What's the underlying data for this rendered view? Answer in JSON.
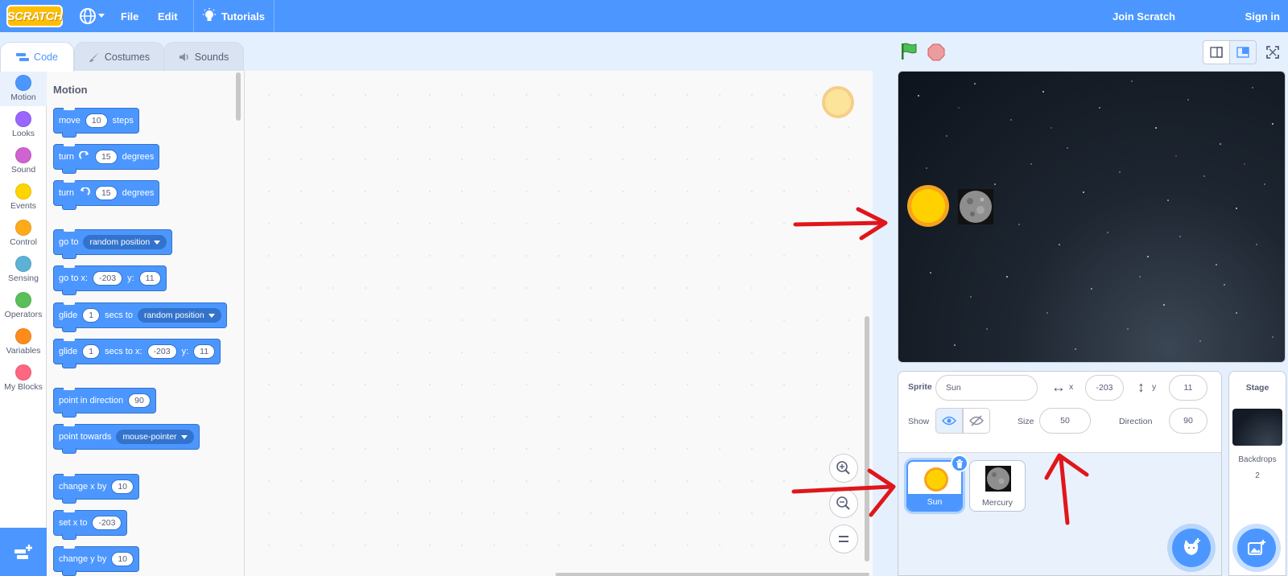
{
  "menubar": {
    "logo_text": "SCRATCH",
    "globe_icon": "globe-icon",
    "file": "File",
    "edit": "Edit",
    "tutorials": "Tutorials",
    "join": "Join Scratch",
    "signin": "Sign in"
  },
  "tabs": [
    {
      "label": "Code",
      "icon": "code-icon",
      "active": true
    },
    {
      "label": "Costumes",
      "icon": "brush-icon",
      "active": false
    },
    {
      "label": "Sounds",
      "icon": "speaker-icon",
      "active": false
    }
  ],
  "categories": [
    {
      "label": "Motion",
      "color": "#4c97ff"
    },
    {
      "label": "Looks",
      "color": "#9966ff"
    },
    {
      "label": "Sound",
      "color": "#cf63cf"
    },
    {
      "label": "Events",
      "color": "#ffd500"
    },
    {
      "label": "Control",
      "color": "#ffab19"
    },
    {
      "label": "Sensing",
      "color": "#5cb1d6"
    },
    {
      "label": "Operators",
      "color": "#59c059"
    },
    {
      "label": "Variables",
      "color": "#ff8c1a"
    },
    {
      "label": "My Blocks",
      "color": "#ff6680"
    }
  ],
  "palette": {
    "heading": "Motion",
    "blocks": {
      "move": {
        "a": "move",
        "v": "10",
        "b": "steps"
      },
      "turn_right": {
        "a": "turn",
        "v": "15",
        "b": "degrees"
      },
      "turn_left": {
        "a": "turn",
        "v": "15",
        "b": "degrees"
      },
      "goto": {
        "a": "go to",
        "dd": "random position"
      },
      "goto_xy": {
        "a": "go to x:",
        "x": "-203",
        "b": "y:",
        "y": "11"
      },
      "glide": {
        "a": "glide",
        "v": "1",
        "b": "secs to",
        "dd": "random position"
      },
      "glide_xy": {
        "a": "glide",
        "v": "1",
        "b": "secs to x:",
        "x": "-203",
        "c": "y:",
        "y": "11"
      },
      "point_dir": {
        "a": "point in direction",
        "v": "90"
      },
      "point_towards": {
        "a": "point towards",
        "dd": "mouse-pointer"
      },
      "change_x": {
        "a": "change x by",
        "v": "10"
      },
      "set_x": {
        "a": "set x to",
        "v": "-203"
      },
      "change_y": {
        "a": "change y by",
        "v": "10"
      }
    }
  },
  "sprite_info": {
    "sprite_label": "Sprite",
    "sprite_name": "Sun",
    "x_label": "x",
    "x": "-203",
    "y_label": "y",
    "y": "11",
    "show_label": "Show",
    "size_label": "Size",
    "size": "50",
    "direction_label": "Direction",
    "direction": "90"
  },
  "sprites": [
    {
      "name": "Sun",
      "selected": true
    },
    {
      "name": "Mercury",
      "selected": false
    }
  ],
  "stage_pane": {
    "title": "Stage",
    "backdrops_label": "Backdrops",
    "backdrops_count": "2"
  },
  "colors": {
    "accent": "#4c97ff",
    "annotation": "#e0161b"
  }
}
